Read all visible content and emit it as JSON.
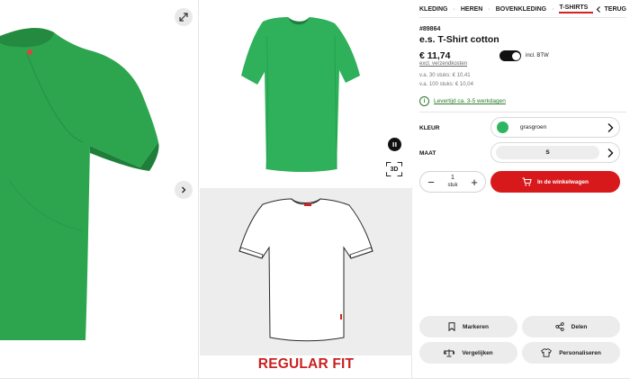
{
  "colors": {
    "accent": "#d8191c",
    "product_green": "#2fb561",
    "delivery_green": "#2c7a2c"
  },
  "gallery": {
    "expand_icon": "expand-icon",
    "next_icon": "chevron-right-icon",
    "pause_icon": "pause-icon",
    "view_3d_label": "3D",
    "fit_label": "REGULAR FIT"
  },
  "breadcrumb": {
    "items": [
      "KLEDING",
      "HEREN",
      "BOVENKLEDING",
      "T-SHIRTS"
    ],
    "back_label": "TERUG"
  },
  "product": {
    "article_no": "#89864",
    "title": "e.s. T-Shirt cotton",
    "price": "€ 11,74",
    "vat_link": "excl. verzendkosten",
    "vat_toggle_label": "incl. BTW",
    "vat_toggle_on": true,
    "tiers": [
      "v.a. 30 stuks: € 10,41",
      "v.a. 100 stuks: € 10,04"
    ],
    "delivery": "Levertijd ca. 3-5 werkdagen"
  },
  "options": {
    "color_label": "KLEUR",
    "color_value": "grasgroen",
    "size_label": "MAAT",
    "size_value": "S"
  },
  "purchase": {
    "qty_value": "1",
    "qty_unit": "stuk",
    "minus": "−",
    "plus": "+",
    "cart_label": "In de winkelwagen"
  },
  "actions": {
    "mark": "Markeren",
    "share": "Delen",
    "compare": "Vergelijken",
    "personalise": "Personaliseren"
  }
}
